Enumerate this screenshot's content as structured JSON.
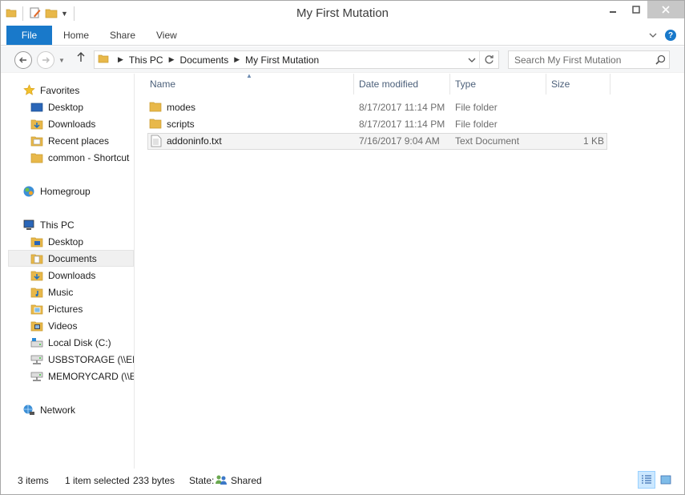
{
  "window": {
    "title": "My First Mutation"
  },
  "ribbon": {
    "file_label": "File",
    "tabs": [
      "Home",
      "Share",
      "View"
    ]
  },
  "address": {
    "crumbs": [
      "This PC",
      "Documents",
      "My First Mutation"
    ]
  },
  "search": {
    "placeholder": "Search My First Mutation"
  },
  "nav": {
    "favorites_label": "Favorites",
    "favorites": [
      "Desktop",
      "Downloads",
      "Recent places",
      "common - Shortcut"
    ],
    "homegroup_label": "Homegroup",
    "thispc_label": "This PC",
    "thispc": [
      "Desktop",
      "Documents",
      "Downloads",
      "Music",
      "Pictures",
      "Videos",
      "Local Disk (C:)",
      "USBSTORAGE (\\\\EPS",
      "MEMORYCARD (\\\\EI"
    ],
    "network_label": "Network",
    "selected": "Documents"
  },
  "columns": {
    "name": "Name",
    "date": "Date modified",
    "type": "Type",
    "size": "Size"
  },
  "files": [
    {
      "name": "modes",
      "date": "8/17/2017 11:14 PM",
      "type": "File folder",
      "size": "",
      "icon": "folder-icon"
    },
    {
      "name": "scripts",
      "date": "8/17/2017 11:14 PM",
      "type": "File folder",
      "size": "",
      "icon": "folder-icon"
    },
    {
      "name": "addoninfo.txt",
      "date": "7/16/2017 9:04 AM",
      "type": "Text Document",
      "size": "1 KB",
      "icon": "text-file-icon"
    }
  ],
  "status": {
    "items": "3 items",
    "selected": "1 item selected",
    "bytes": "233 bytes",
    "state_label": "State:",
    "state_value": "Shared"
  },
  "colors": {
    "accent": "#1979ca",
    "folder": "#e8b84a",
    "header_text": "#4c607a"
  }
}
